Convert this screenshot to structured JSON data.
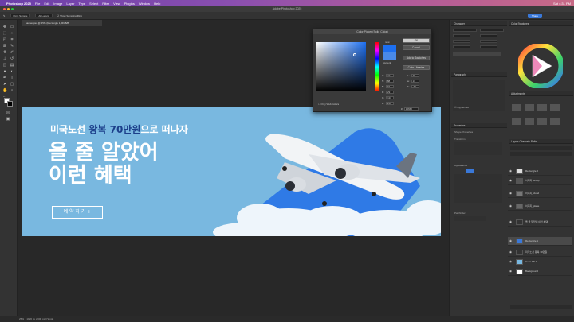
{
  "menubar": {
    "apple": "",
    "app": "Photoshop 2025",
    "items": [
      "File",
      "Edit",
      "Image",
      "Layer",
      "Type",
      "Select",
      "Filter",
      "View",
      "Plugins",
      "Window",
      "Help"
    ],
    "right": "Sat 4:31 PM"
  },
  "titlebar": {
    "title": "Adobe Photoshop 2025"
  },
  "optbar": {
    "sample_size": "Point Sample",
    "sample": "All Layers",
    "show_ring": "Show Sampling Ring",
    "share": "Share"
  },
  "doc": {
    "tab": "banner.psd @ 25% (Rectangle 1, RGB/8)"
  },
  "banner": {
    "line1_pre": "미국노선 ",
    "line1_hl": "왕복 70만원",
    "line1_post": "으로 떠나자",
    "line2": "올 줄 알았어",
    "line3": "이런 혜택",
    "button": "예 약 하 기 +"
  },
  "picker": {
    "title": "Color Picker (Solid Color)",
    "ok": "OK",
    "cancel": "Cancel",
    "add_swatches": "Add to Swatches",
    "libraries": "Color Libraries",
    "new": "new",
    "current": "current",
    "web_only": "Only Web Colors",
    "values": [
      {
        "label": "H:",
        "value": "214"
      },
      {
        "label": "S:",
        "value": "88"
      },
      {
        "label": "B:",
        "value": "94"
      },
      {
        "label": "R:",
        "value": "29"
      },
      {
        "label": "G:",
        "value": "111"
      },
      {
        "label": "B:",
        "value": "240"
      }
    ],
    "lab": [
      {
        "label": "L:",
        "value": "49"
      },
      {
        "label": "a:",
        "value": "13"
      },
      {
        "label": "b:",
        "value": "-72"
      }
    ],
    "hex": "1d6ff0",
    "new_color": "#1d6ff0",
    "current_color": "#4a8ae8"
  },
  "panels": {
    "character": "Character",
    "paragraph": "Paragraph",
    "color": "Color",
    "swatches": "Swatches",
    "adjustments": "Adjustments",
    "properties": "Properties",
    "layers": "Layers",
    "channels": "Channels",
    "paths": "Paths",
    "libraries": "Libraries",
    "hyphenate": "Hyphenate",
    "transform": "Transform",
    "appearance": "Appearance",
    "pathfinder": "Pathfinder",
    "shape_props": "Shape Properties"
  },
  "layers": [
    {
      "name": "Rectangle 2"
    },
    {
      "name": "이미지 Group"
    },
    {
      "name": "이미지_cloud"
    },
    {
      "name": "이미지_plane"
    },
    {
      "name": "올 줄 알았어 이런 혜택"
    },
    {
      "name": "Rectangle 1"
    },
    {
      "name": "미국노선 왕복 70만원"
    },
    {
      "name": "Color Fill 1"
    },
    {
      "name": "Background"
    }
  ],
  "status": {
    "zoom": "25%",
    "doc_size": "1920 px x 600 px (72 ppi)"
  },
  "colors": {
    "banner_bg": "#79b8e0",
    "highlight": "#1c3f8a",
    "accent_blue": "#3a78d8"
  }
}
